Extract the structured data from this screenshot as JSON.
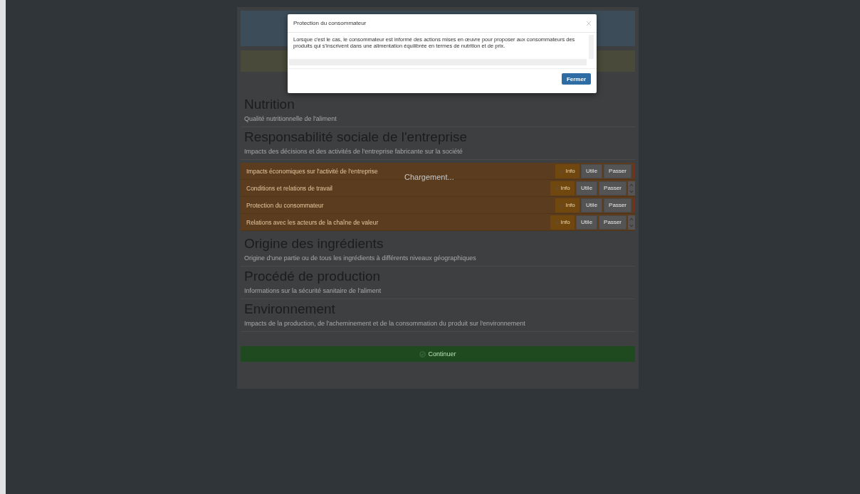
{
  "modal": {
    "title": "Protection du consommateur",
    "body": "Lorsque c'est le cas, le consommateur est informé des actions mises en œuvre pour proposer aux consommateurs des produits qui s'inscrivent dans une alimentation équilibrée en termes de nutrition et de prix.",
    "close_button": "Fermer"
  },
  "sections": [
    {
      "title": "Nutrition",
      "description": "Qualité nutritionnelle de l'aliment"
    },
    {
      "title": "Responsabilité sociale de l'entreprise",
      "description": "Impacts des décisions et des activités de l'entreprise fabricante sur la société",
      "items": [
        {
          "label": "Impacts économiques sur l'activité de l'entreprise",
          "info": "Info",
          "useful": "Utile",
          "skip": "Passer",
          "spinner": false
        },
        {
          "label": "Conditions et relations de travail",
          "info": "Info",
          "useful": "Utile",
          "skip": "Passer",
          "spinner": true
        },
        {
          "label": "Protection du consommateur",
          "info": "Info",
          "useful": "Utile",
          "skip": "Passer",
          "spinner": false
        },
        {
          "label": "Relations avec les acteurs de la chaîne de valeur",
          "info": "Info",
          "useful": "Utile",
          "skip": "Passer",
          "spinner": true
        }
      ]
    },
    {
      "title": "Origine des ingrédients",
      "description": "Origine d'une partie ou de tous les ingrédients à différents niveaux géographiques"
    },
    {
      "title": "Procédé de production",
      "description": "Informations sur la sécurité sanitaire de l'aliment"
    },
    {
      "title": "Environnement",
      "description": "Impacts de la production, de l'acheminement et de la consommation du produit sur l'environnement"
    }
  ],
  "loading": "Chargement...",
  "continue_button": "Continuer"
}
